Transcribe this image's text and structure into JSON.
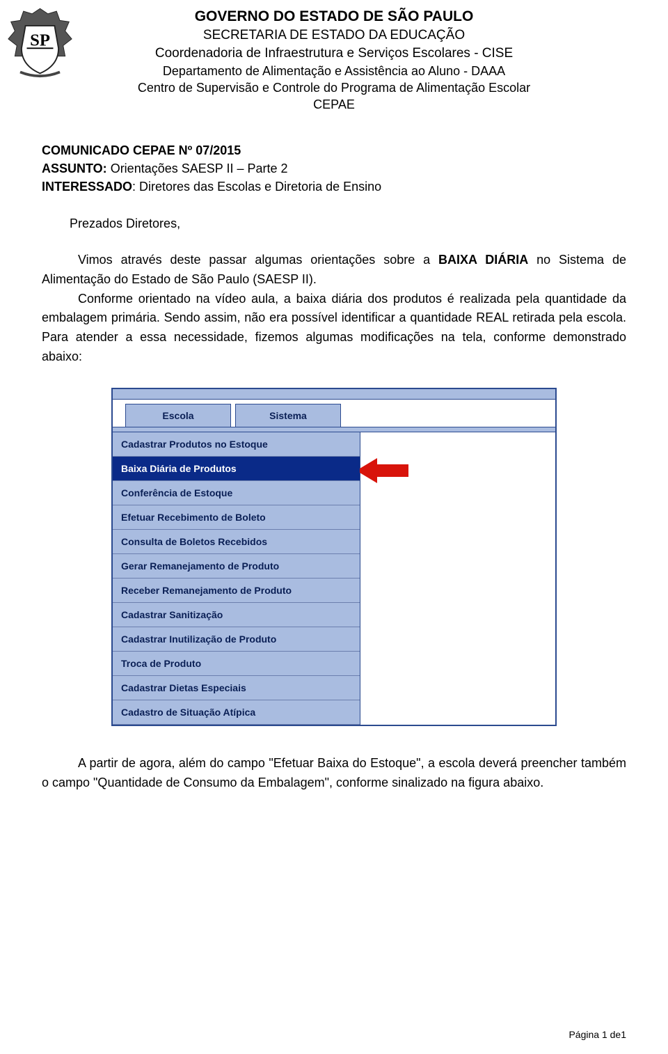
{
  "header": {
    "line1": "GOVERNO DO ESTADO DE SÃO PAULO",
    "line2": "SECRETARIA DE ESTADO DA EDUCAÇÃO",
    "line3": "Coordenadoria de Infraestrutura e Serviços Escolares - CISE",
    "line4": "Departamento de Alimentação e Assistência ao Aluno - DAAA",
    "line5": "Centro de Supervisão e Controle do Programa de Alimentação Escolar",
    "line6": "CEPAE",
    "crest_alt": "sp-state-crest"
  },
  "meta": {
    "comunicado_label": "COMUNICADO CEPAE Nº 07/2015",
    "assunto_label": "ASSUNTO:",
    "assunto_value": " Orientações SAESP II – Parte 2",
    "interessado_label": "INTERESSADO",
    "interessado_value": ": Diretores das Escolas e Diretoria de Ensino"
  },
  "salutation": "Prezados Diretores,",
  "paragraph1": {
    "p1": "Vimos através deste passar algumas orientações sobre a ",
    "bold1": "BAIXA DIÁRIA",
    "p2": " no Sistema de Alimentação do Estado de São Paulo (SAESP II).",
    "p3": "Conforme orientado na vídeo aula, a baixa diária dos produtos é realizada pela quantidade da embalagem primária. Sendo assim, não era possível identificar a quantidade REAL retirada pela escola. Para atender a essa necessidade, fizemos algumas modificações na tela, conforme demonstrado abaixo:"
  },
  "menu": {
    "tabs": [
      "Escola",
      "Sistema"
    ],
    "items": [
      {
        "label": "Cadastrar Produtos no Estoque",
        "selected": false
      },
      {
        "label": "Baixa Diária de Produtos",
        "selected": true
      },
      {
        "label": "Conferência de Estoque",
        "selected": false
      },
      {
        "label": "Efetuar Recebimento de Boleto",
        "selected": false
      },
      {
        "label": "Consulta de Boletos Recebidos",
        "selected": false
      },
      {
        "label": "Gerar Remanejamento de Produto",
        "selected": false
      },
      {
        "label": "Receber Remanejamento de Produto",
        "selected": false
      },
      {
        "label": "Cadastrar Sanitização",
        "selected": false
      },
      {
        "label": "Cadastrar Inutilização de Produto",
        "selected": false
      },
      {
        "label": "Troca de Produto",
        "selected": false
      },
      {
        "label": "Cadastrar Dietas Especiais",
        "selected": false
      },
      {
        "label": "Cadastro de Situação Atípica",
        "selected": false
      }
    ],
    "arrow_color": "#d8140b"
  },
  "paragraph2": {
    "p1": "A partir de agora, além do campo ",
    "q1": "\"Efetuar Baixa do Estoque\"",
    "p2": ", a escola deverá preencher também o campo ",
    "q2": "\"Quantidade de Consumo da Embalagem\"",
    "p3": ", conforme sinalizado na figura abaixo."
  },
  "footer": "Página 1 de1"
}
